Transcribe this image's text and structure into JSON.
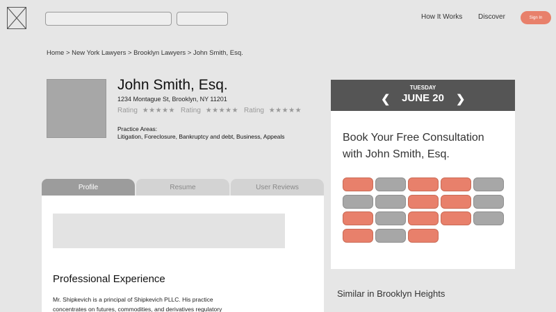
{
  "header": {
    "logo_icon": "image-placeholder-icon",
    "nav": [
      "How It Works",
      "Discover"
    ],
    "signin_label": "Sign In",
    "accent_color": "#e8806b"
  },
  "breadcrumb": "Home > New York Lawyers > Brooklyn Lawyers > John Smith, Esq.",
  "profile": {
    "name": "John Smith, Esq.",
    "address": "1234 Montague St, Brooklyn, NY 11201",
    "ratings": [
      {
        "label": "Rating",
        "stars": "★★★★★"
      },
      {
        "label": "Rating",
        "stars": "★★★★★"
      },
      {
        "label": "Rating",
        "stars": "★★★★★"
      }
    ],
    "practice_title": "Practice Areas:",
    "practice_list": "Litigation, Foreclosure, Bankruptcy and debt, Business, Appeals"
  },
  "tabs": [
    "Profile",
    "Resume",
    "User Reviews"
  ],
  "content": {
    "section_title": "Professional Experience",
    "bio": "Mr. Shipkevich is a principal of Shipkevich PLLC. His practice concentrates on futures, commodities, and derivatives regulatory"
  },
  "booking": {
    "day": "TUESDAY",
    "date": "JUNE 20",
    "title": "Book Your Free Consultation with John Smith, Esq.",
    "slots": [
      "open",
      "booked",
      "open",
      "open",
      "booked",
      "booked",
      "booked",
      "open",
      "open",
      "booked",
      "open",
      "booked",
      "open",
      "open",
      "booked",
      "open",
      "booked",
      "open"
    ]
  },
  "similar_title": "Similar in Brooklyn Heights"
}
